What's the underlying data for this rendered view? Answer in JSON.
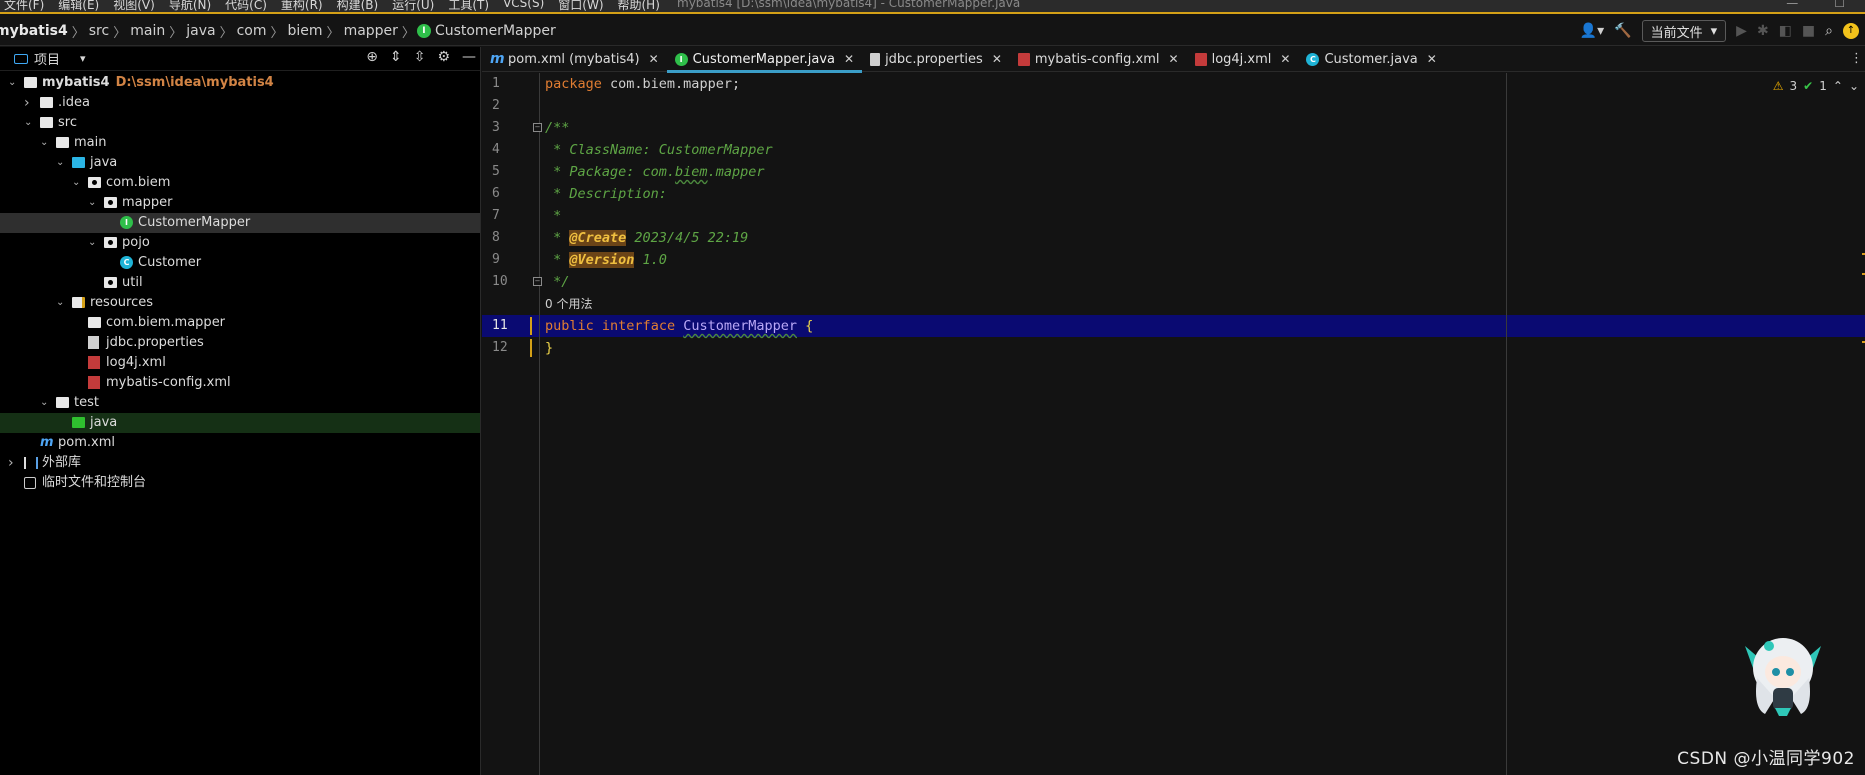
{
  "menubar": {
    "items": [
      "文件(F)",
      "编辑(E)",
      "视图(V)",
      "导航(N)",
      "代码(C)",
      "重构(R)",
      "构建(B)",
      "运行(U)",
      "工具(T)",
      "VCS(S)",
      "窗口(W)",
      "帮助(H)"
    ],
    "window_title": "mybatis4 [D:\\ssm\\idea\\mybatis4] - CustomerMapper.java"
  },
  "breadcrumb": [
    "mybatis4",
    "src",
    "main",
    "java",
    "com",
    "biem",
    "mapper",
    "CustomerMapper"
  ],
  "toolbar": {
    "run_config_label": "当前文件"
  },
  "project_panel": {
    "title": "项目",
    "tree": [
      {
        "label": "mybatis4",
        "hint": "D:\\ssm\\idea\\mybatis4",
        "depth": 0,
        "arrow": "open",
        "icon": "module"
      },
      {
        "label": ".idea",
        "depth": 1,
        "arrow": "closed",
        "icon": "folder"
      },
      {
        "label": "src",
        "depth": 1,
        "arrow": "open",
        "icon": "folder"
      },
      {
        "label": "main",
        "depth": 2,
        "arrow": "open",
        "icon": "folder"
      },
      {
        "label": "java",
        "depth": 3,
        "arrow": "open",
        "icon": "folder-blue"
      },
      {
        "label": "com.biem",
        "depth": 4,
        "arrow": "open",
        "icon": "package"
      },
      {
        "label": "mapper",
        "depth": 5,
        "arrow": "open",
        "icon": "package"
      },
      {
        "label": "CustomerMapper",
        "depth": 6,
        "arrow": "none",
        "icon": "interface",
        "selected": true
      },
      {
        "label": "pojo",
        "depth": 5,
        "arrow": "open",
        "icon": "package"
      },
      {
        "label": "Customer",
        "depth": 6,
        "arrow": "none",
        "icon": "class"
      },
      {
        "label": "util",
        "depth": 5,
        "arrow": "none",
        "icon": "package"
      },
      {
        "label": "resources",
        "depth": 3,
        "arrow": "open",
        "icon": "resources"
      },
      {
        "label": "com.biem.mapper",
        "depth": 4,
        "arrow": "none",
        "icon": "folder"
      },
      {
        "label": "jdbc.properties",
        "depth": 4,
        "arrow": "none",
        "icon": "properties"
      },
      {
        "label": "log4j.xml",
        "depth": 4,
        "arrow": "none",
        "icon": "xml"
      },
      {
        "label": "mybatis-config.xml",
        "depth": 4,
        "arrow": "none",
        "icon": "xml"
      },
      {
        "label": "test",
        "depth": 2,
        "arrow": "open",
        "icon": "folder"
      },
      {
        "label": "java",
        "depth": 3,
        "arrow": "none",
        "icon": "folder-green",
        "selected_green": true
      },
      {
        "label": "pom.xml",
        "depth": 1,
        "arrow": "none",
        "icon": "pom"
      },
      {
        "label": "外部库",
        "depth": 0,
        "arrow": "closed",
        "icon": "library"
      },
      {
        "label": "临时文件和控制台",
        "depth": 0,
        "arrow": "none",
        "icon": "scratch"
      }
    ]
  },
  "tabs": [
    {
      "label": "pom.xml (mybatis4)",
      "icon": "m"
    },
    {
      "label": "CustomerMapper.java",
      "icon": "i",
      "active": true
    },
    {
      "label": "jdbc.properties",
      "icon": "p"
    },
    {
      "label": "mybatis-config.xml",
      "icon": "x2"
    },
    {
      "label": "log4j.xml",
      "icon": "x2"
    },
    {
      "label": "Customer.java",
      "icon": "c"
    }
  ],
  "editor": {
    "line_numbers": [
      "1",
      "2",
      "3",
      "4",
      "5",
      "6",
      "7",
      "8",
      "9",
      "10",
      "11",
      "12"
    ],
    "current_line": "11",
    "usage_hint": "0 个用法",
    "code": {
      "l1_kw": "package",
      "l1_rest": " com.biem.mapper;",
      "l3": "/**",
      "l4": " * ClassName: CustomerMapper",
      "l5_a": " * Package: com.",
      "l5_b": "biem",
      "l5_c": ".mapper",
      "l6": " * Description:",
      "l7": " *",
      "l8_a": " * ",
      "l8_ann": "@Create",
      "l8_rest": " 2023/4/5 22:19",
      "l9_a": " * ",
      "l9_ann": "@Version",
      "l9_rest": " 1.0",
      "l10": " */",
      "l11_kw1": "public",
      "l11_kw2": "interface",
      "l11_name": "CustomerMapper",
      "l11_brace": "{",
      "l12": "}"
    },
    "inspections": {
      "warnings": "3",
      "ok": "1"
    }
  },
  "watermark": "CSDN @小温同学902",
  "colors": {
    "accent": "#3b9ec8",
    "keyword": "#e07d32",
    "comment": "#5ea545",
    "current_line": "#0a0a72"
  }
}
